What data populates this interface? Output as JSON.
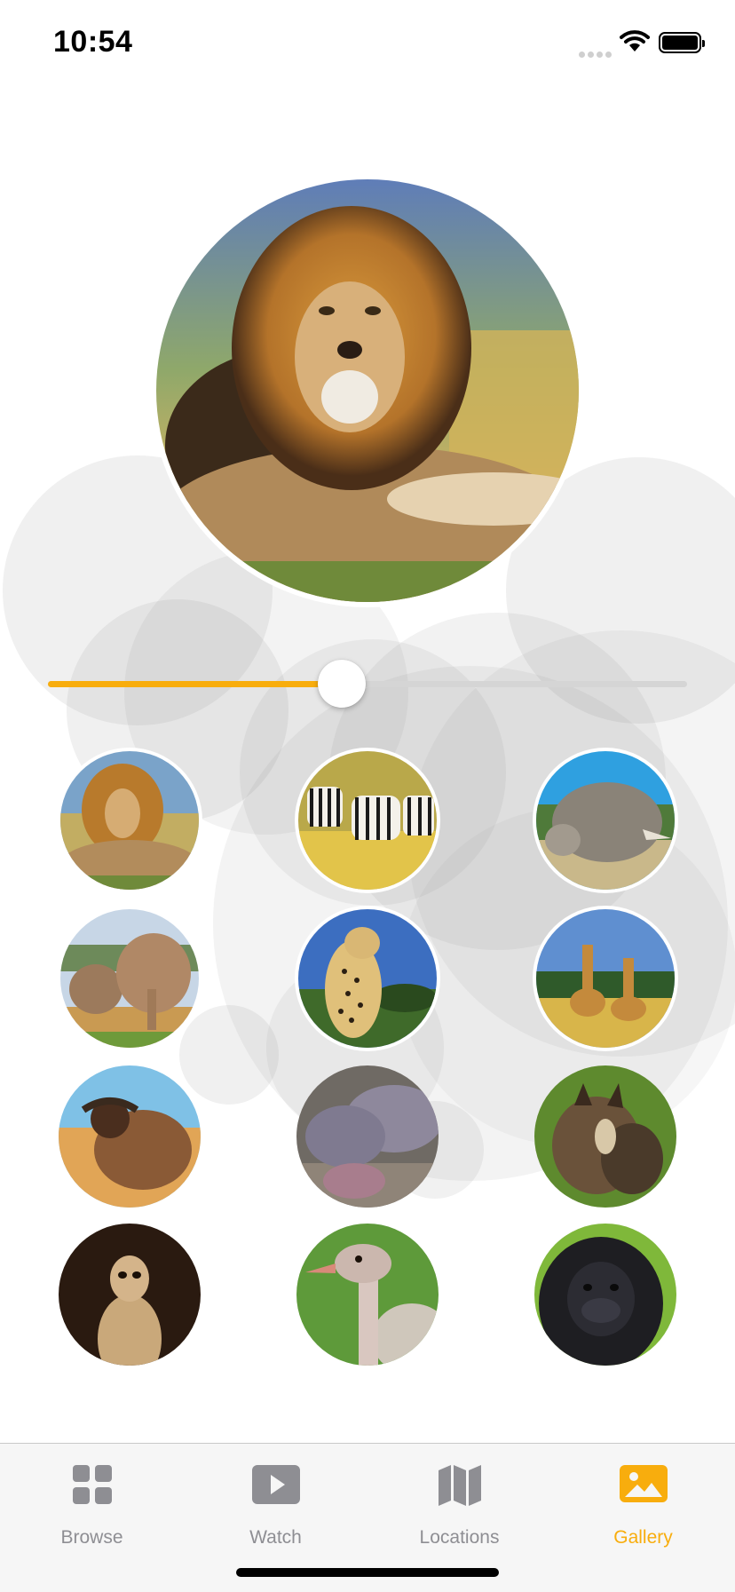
{
  "status_bar": {
    "time": "10:54"
  },
  "gallery": {
    "selected": "lion",
    "slider_value": 0.46,
    "thumbnails": [
      {
        "animal": "lion"
      },
      {
        "animal": "zebra"
      },
      {
        "animal": "rhino"
      },
      {
        "animal": "elephant"
      },
      {
        "animal": "cheetah"
      },
      {
        "animal": "giraffe"
      },
      {
        "animal": "buffalo"
      },
      {
        "animal": "hippo"
      },
      {
        "animal": "wild-dog"
      },
      {
        "animal": "meerkat"
      },
      {
        "animal": "ostrich"
      },
      {
        "animal": "gorilla"
      }
    ]
  },
  "tabs": [
    {
      "label": "Browse",
      "icon": "grid-icon"
    },
    {
      "label": "Watch",
      "icon": "play-icon"
    },
    {
      "label": "Locations",
      "icon": "map-icon"
    },
    {
      "label": "Gallery",
      "icon": "photo-icon",
      "active": true
    }
  ],
  "colors": {
    "accent": "#f8ad0d",
    "inactive": "#8e8e93",
    "bubble": "#8a8a8a"
  }
}
